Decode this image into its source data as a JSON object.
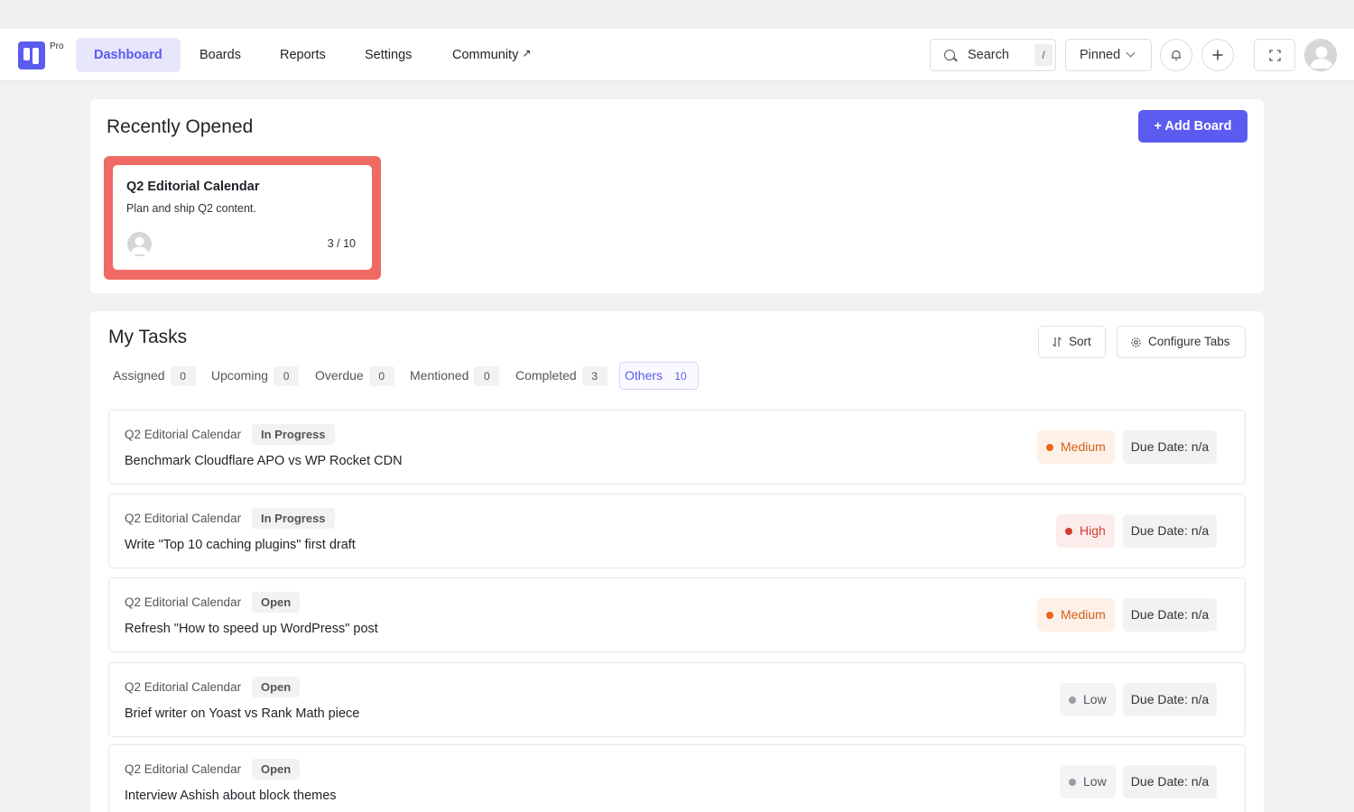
{
  "app": {
    "logo_badge": "Pro"
  },
  "nav": {
    "items": [
      {
        "label": "Dashboard"
      },
      {
        "label": "Boards"
      },
      {
        "label": "Reports"
      },
      {
        "label": "Settings"
      },
      {
        "label": "Community"
      }
    ],
    "active": "Dashboard",
    "external_marker": "↗"
  },
  "header": {
    "search_label": "Search",
    "search_shortcut": "/",
    "pinned_label": "Pinned",
    "icons": [
      "search-icon",
      "chevron-down-icon",
      "bell-icon",
      "plus-icon",
      "fullscreen-icon",
      "user-avatar"
    ]
  },
  "recent": {
    "title": "Recently Opened",
    "add_board_label": "+ Add Board",
    "boards": [
      {
        "title": "Q2 Editorial Calendar",
        "description": "Plan and ship Q2 content.",
        "progress": "3 / 10"
      }
    ]
  },
  "tasks": {
    "title": "My Tasks",
    "sort_label": "Sort",
    "configure_label": "Configure Tabs",
    "tabs": [
      {
        "label": "Assigned",
        "count": "0"
      },
      {
        "label": "Upcoming",
        "count": "0"
      },
      {
        "label": "Overdue",
        "count": "0"
      },
      {
        "label": "Mentioned",
        "count": "0"
      },
      {
        "label": "Completed",
        "count": "3"
      },
      {
        "label": "Others",
        "count": "10"
      }
    ],
    "active_tab": "Others",
    "list": [
      {
        "board": "Q2 Editorial Calendar",
        "status": "In Progress",
        "title": "Benchmark Cloudflare APO vs WP Rocket CDN",
        "priority": "Medium",
        "due": "Due Date: n/a"
      },
      {
        "board": "Q2 Editorial Calendar",
        "status": "In Progress",
        "title": "Write \"Top 10 caching plugins\" first draft",
        "priority": "High",
        "due": "Due Date: n/a"
      },
      {
        "board": "Q2 Editorial Calendar",
        "status": "Open",
        "title": "Refresh \"How to speed up WordPress\" post",
        "priority": "Medium",
        "due": "Due Date: n/a"
      },
      {
        "board": "Q2 Editorial Calendar",
        "status": "Open",
        "title": "Brief writer on Yoast vs Rank Math piece",
        "priority": "Low",
        "due": "Due Date: n/a"
      },
      {
        "board": "Q2 Editorial Calendar",
        "status": "Open",
        "title": "Interview Ashish about block themes",
        "priority": "Low",
        "due": "Due Date: n/a"
      }
    ]
  },
  "colors": {
    "accent": "#5b5bf0",
    "highlight": "#ee6a63",
    "medium_bg": "#fdf1e7",
    "medium_fg": "#d0601c",
    "high_bg": "#fdecec",
    "high_fg": "#d23b32",
    "low_bg": "#f3f4f6",
    "low_fg": "#555555"
  }
}
